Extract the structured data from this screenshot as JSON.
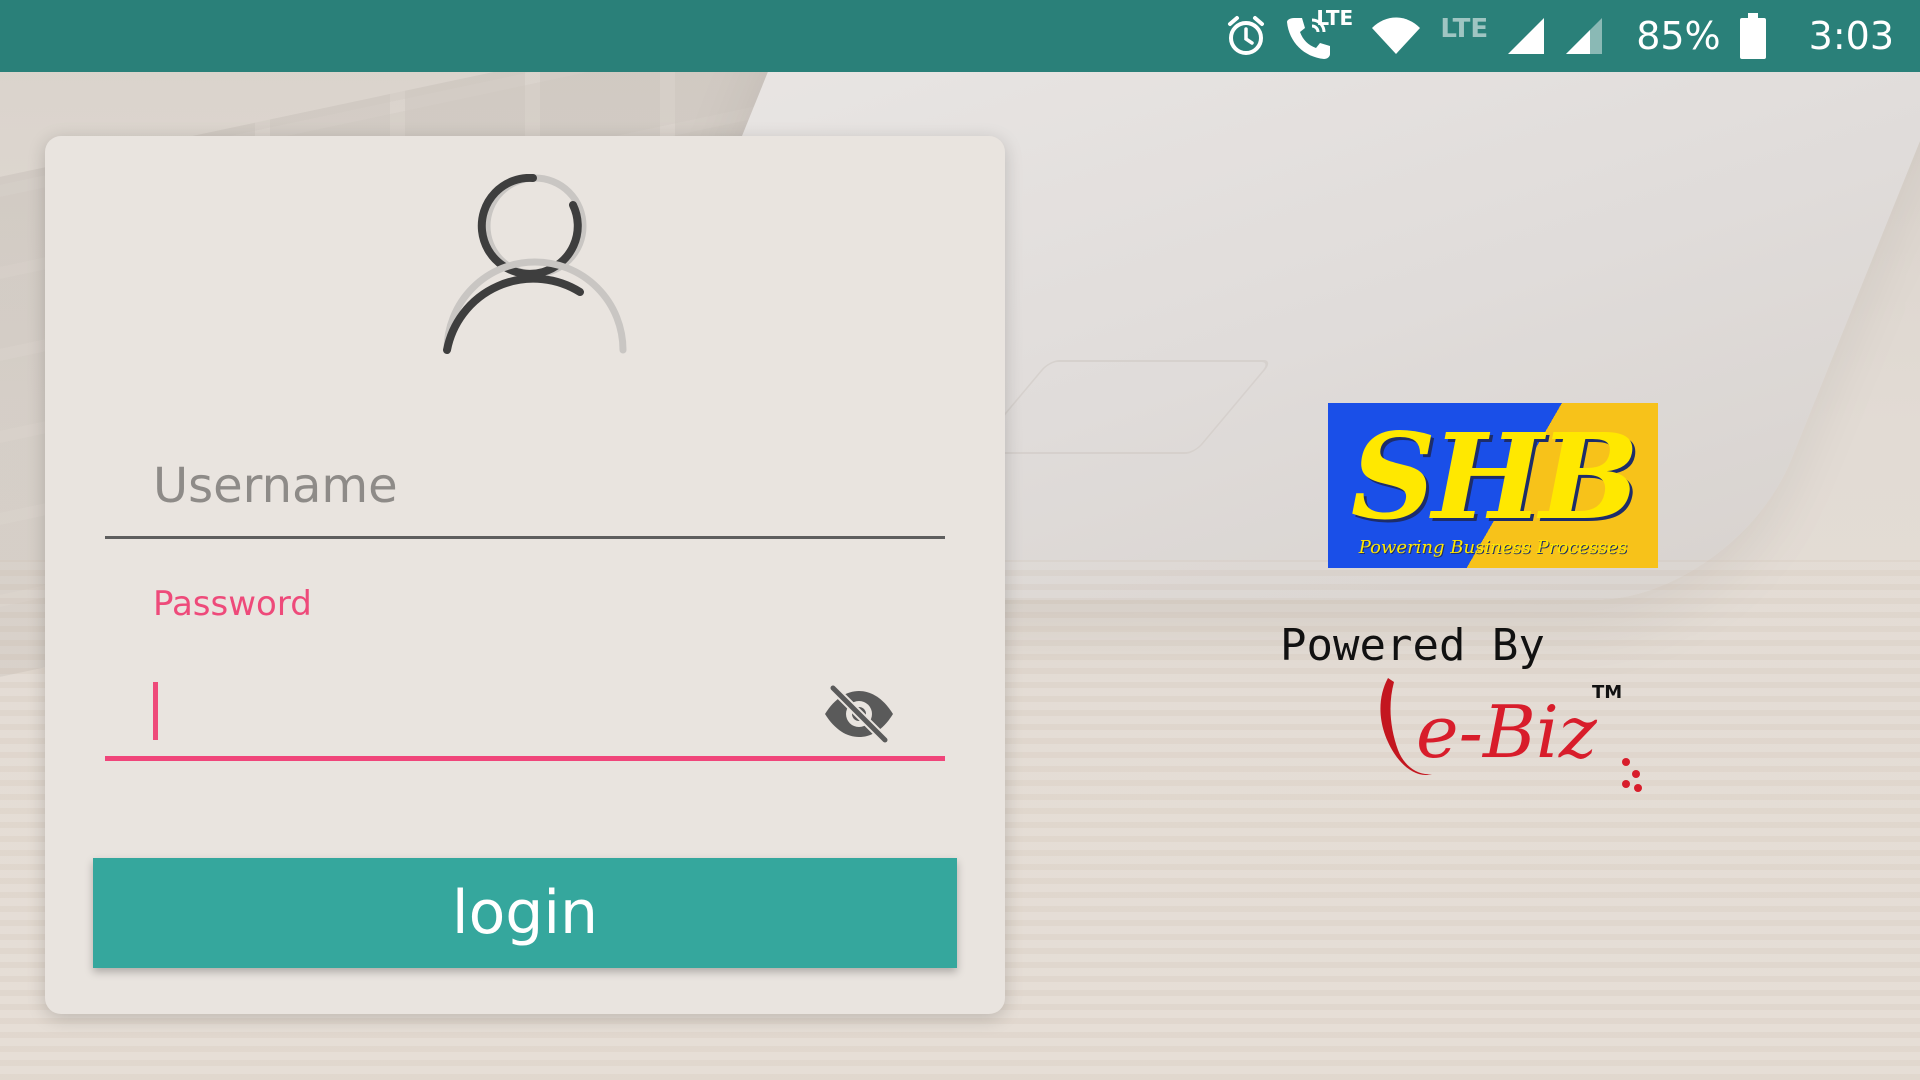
{
  "status_bar": {
    "network_label": "LTE",
    "call_network_label": "LTE",
    "battery": "85%",
    "time": "3:03",
    "icons": [
      "alarm-icon",
      "wifi-calling-icon",
      "wifi-icon",
      "signal-icon",
      "signal-icon",
      "battery-icon"
    ]
  },
  "login": {
    "username_placeholder": "Username",
    "username_value": "",
    "password_label": "Password",
    "password_value": "",
    "login_label": "login"
  },
  "branding": {
    "logo_text": "SHB",
    "logo_tagline": "Powering Business Processes",
    "powered_by": "Powered By",
    "partner_logo_text": "e-Biz",
    "partner_tm": "TM"
  },
  "colors": {
    "status_bar": "#2a8079",
    "accent_pink": "#f0457a",
    "button": "#35a79d"
  }
}
